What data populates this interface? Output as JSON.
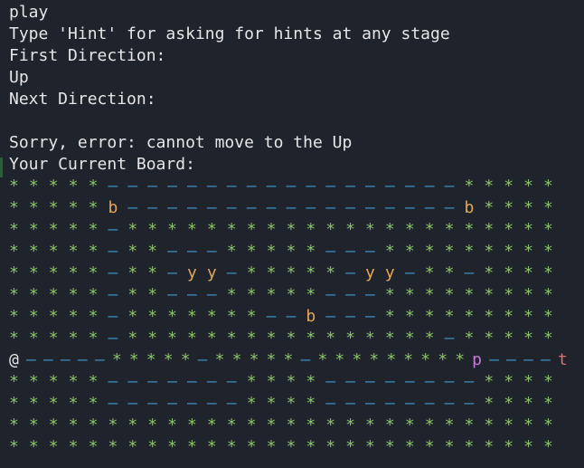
{
  "terminal": {
    "lines": [
      "play",
      "Type 'Hint' for asking for hints at any stage",
      "First Direction:",
      "Up",
      "Next Direction:",
      "",
      "Sorry, error: cannot move to the Up",
      "Your Current Board:"
    ]
  },
  "board": {
    "rows": [
      "*****––––––––––––––––––*****",
      "*****b–––––––––––––––––b****",
      "*****–**********************",
      "*****–**–––*****–––*********",
      "*****–**–yy–*****–yy–**–****",
      "*****–**–––*****–––*********",
      "*****–*******––b–––*********",
      "*****–****************–*****",
      "@–––––*****–*****–*********p––––t",
      "*****–––––––****––––––––****",
      "*****–––––––****––––––––****",
      "****************************",
      "****************************"
    ]
  },
  "colors": {
    "background": "#1f232b",
    "text": "#e6e6e6",
    "star": "#8cc26a",
    "dash": "#3f8fbf",
    "b": "#e3a65a",
    "y": "#e3a65a",
    "p": "#c47bd6",
    "t": "#e06c6c"
  }
}
